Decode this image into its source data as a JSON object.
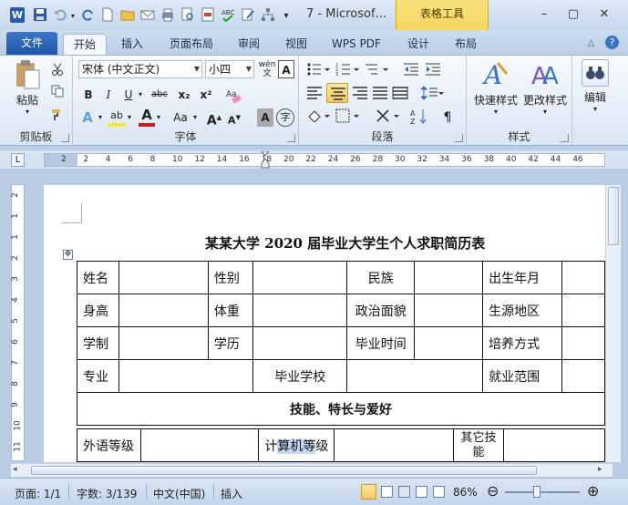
{
  "app": {
    "logo_letter": "W",
    "title": "7 - Microsof…",
    "context_group": "表格工具"
  },
  "tabs": {
    "file": "文件",
    "items": [
      "开始",
      "插入",
      "页面布局",
      "审阅",
      "视图",
      "WPS PDF",
      "设计",
      "布局"
    ]
  },
  "ribbon": {
    "clipboard": {
      "label": "剪贴板",
      "paste": "粘贴"
    },
    "font": {
      "label": "字体",
      "font_name": "宋体 (中文正文)",
      "font_size": "小四",
      "wen_icon": "wén",
      "bold": "B",
      "italic": "I",
      "underline": "U",
      "strike": "abc",
      "sub": "x₂",
      "sup": "x²",
      "grow": "A",
      "shrink": "A",
      "case": "Aa",
      "char_shading": "A",
      "enclose": "字"
    },
    "paragraph": {
      "label": "段落"
    },
    "styles": {
      "label": "样式",
      "quick_styles": "快速样式",
      "change_styles": "更改样式"
    },
    "editing": {
      "label": "编辑",
      "button": "编辑"
    }
  },
  "ruler": {
    "h_numbers": [
      "2",
      "2",
      "4",
      "6",
      "8",
      "10",
      "12",
      "14",
      "16",
      "18",
      "20",
      "22",
      "24",
      "26",
      "28",
      "30",
      "32",
      "34",
      "36",
      "38",
      "40",
      "42",
      "44",
      "46"
    ],
    "v_numbers": [
      "2",
      "1",
      "1",
      "2",
      "3",
      "4",
      "5",
      "6",
      "7",
      "8",
      "9",
      "10",
      "11",
      "12"
    ]
  },
  "document": {
    "title": "某某大学 2020 届毕业大学生个人求职简历表",
    "row1": [
      "姓名",
      "",
      "性别",
      "",
      "民族",
      "",
      "出生年月",
      ""
    ],
    "row2": [
      "身高",
      "",
      "体重",
      "",
      "政治面貌",
      "",
      "生源地区",
      ""
    ],
    "row3": [
      "学制",
      "",
      "学历",
      "",
      "毕业时间",
      "",
      "培养方式",
      ""
    ],
    "row4": [
      "专业",
      "",
      "毕业学校",
      "",
      "就业范围",
      ""
    ],
    "section_header": "技能、特长与爱好",
    "row5": {
      "lang": "外语等级",
      "comp_pre": "计",
      "comp_hl": "算机等",
      "comp_post": "级",
      "other": "其它技能"
    }
  },
  "status": {
    "page": "页面: 1/1",
    "words": "字数: 3/139",
    "language": "中文(中国)",
    "mode": "插入",
    "zoom": "86%"
  },
  "colors": {
    "file_tab": "#1f56a8",
    "context_tab": "#f3ce45",
    "selection": "#c7d8f1"
  }
}
